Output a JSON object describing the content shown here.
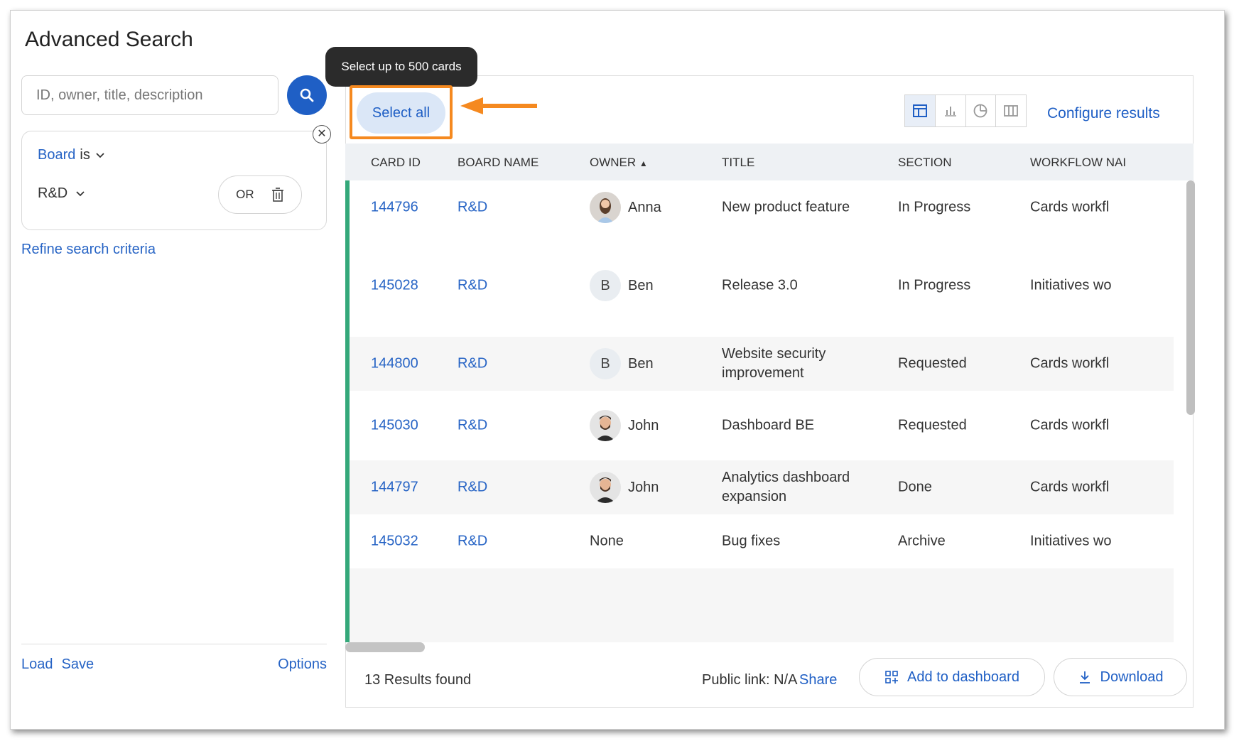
{
  "page": {
    "title": "Advanced Search"
  },
  "search": {
    "placeholder": "ID, owner, title, description"
  },
  "criteria": {
    "field": "Board",
    "operator": "is",
    "value": "R&D",
    "or_label": "OR"
  },
  "refine_label": "Refine search criteria",
  "left_footer": {
    "load": "Load",
    "save": "Save",
    "options": "Options"
  },
  "tooltip": "Select up to 500 cards",
  "select_all_label": "Select all",
  "configure_label": "Configure results",
  "columns": [
    "Card ID",
    "Board name",
    "Owner",
    "Title",
    "Section",
    "Workflow nai"
  ],
  "sort_indicator": "▲",
  "rows": [
    {
      "id": "144796",
      "board": "R&D",
      "owner": "Anna",
      "avatar": "photo-female",
      "title": "New product feature",
      "section": "In Progress",
      "workflow": "Cards workfl"
    },
    {
      "id": "145028",
      "board": "R&D",
      "owner": "Ben",
      "avatar": "initial",
      "initial": "B",
      "title": "Release 3.0",
      "section": "In Progress",
      "workflow": "Initiatives wo"
    },
    {
      "id": "144800",
      "board": "R&D",
      "owner": "Ben",
      "avatar": "initial",
      "initial": "B",
      "title": "Website security improvement",
      "section": "Requested",
      "workflow": "Cards workfl"
    },
    {
      "id": "145030",
      "board": "R&D",
      "owner": "John",
      "avatar": "photo-male",
      "title": "Dashboard BE",
      "section": "Requested",
      "workflow": "Cards workfl"
    },
    {
      "id": "144797",
      "board": "R&D",
      "owner": "John",
      "avatar": "photo-male",
      "title": "Analytics dashboard expansion",
      "section": "Done",
      "workflow": "Cards workfl"
    },
    {
      "id": "145032",
      "board": "R&D",
      "owner": "None",
      "avatar": "none",
      "title": "Bug fixes",
      "section": "Archive",
      "workflow": "Initiatives wo"
    }
  ],
  "footer": {
    "results_count": "13 Results found",
    "public_link": "Public link: N/A",
    "share": "Share",
    "add_dashboard": "Add to dashboard",
    "download": "Download"
  },
  "colors": {
    "accent_blue": "#1f5fc5",
    "highlight_orange": "#f5891f",
    "row_accent_green": "#34a87a"
  }
}
